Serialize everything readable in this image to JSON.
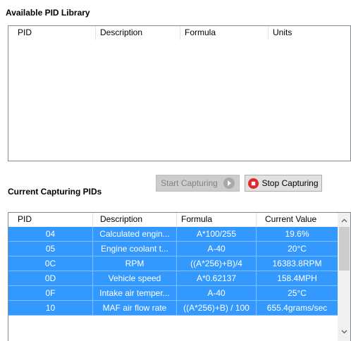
{
  "library": {
    "title": "Available PID Library",
    "columns": [
      "PID",
      "Description",
      "Formula",
      "Units"
    ]
  },
  "capturing": {
    "title": "Current Capturing PIDs",
    "start_label": "Start Capturing",
    "stop_label": "Stop Capturing",
    "columns": [
      "PID",
      "Description",
      "Formula",
      "Current Value"
    ],
    "rows": [
      {
        "pid": "04",
        "description": "Calculated engin...",
        "formula": "A*100/255",
        "value": "19.6%"
      },
      {
        "pid": "05",
        "description": "Engine coolant t...",
        "formula": "A-40",
        "value": "20°C"
      },
      {
        "pid": "0C",
        "description": "RPM",
        "formula": "((A*256)+B)/4",
        "value": "16383.8RPM"
      },
      {
        "pid": "0D",
        "description": "Vehicle speed",
        "formula": "A*0.62137",
        "value": "158.4MPH"
      },
      {
        "pid": "0F",
        "description": "Intake air temper...",
        "formula": "A-40",
        "value": "25°C"
      },
      {
        "pid": "10",
        "description": "MAF air flow rate",
        "formula": "((A*256)+B) / 100",
        "value": "655.4grams/sec"
      }
    ]
  },
  "colors": {
    "selection": "#3399ff",
    "stop_icon": "#e02a2a",
    "start_icon": "#a0a0a0"
  },
  "icons": {
    "start": "play-circle-icon",
    "stop": "stop-circle-icon",
    "scroll_up": "chevron-up-icon",
    "scroll_down": "chevron-down-icon"
  }
}
